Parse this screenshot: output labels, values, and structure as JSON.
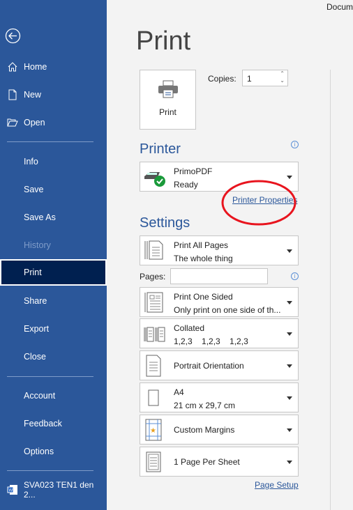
{
  "window_title": "Docum",
  "sidebar": {
    "items": [
      {
        "label": "Home",
        "icon": "home-icon"
      },
      {
        "label": "New",
        "icon": "new-document-icon"
      },
      {
        "label": "Open",
        "icon": "folder-open-icon"
      },
      {
        "label": "Info"
      },
      {
        "label": "Save"
      },
      {
        "label": "Save As"
      },
      {
        "label": "History",
        "disabled": true
      },
      {
        "label": "Print",
        "selected": true
      },
      {
        "label": "Share"
      },
      {
        "label": "Export"
      },
      {
        "label": "Close"
      },
      {
        "label": "Account"
      },
      {
        "label": "Feedback"
      },
      {
        "label": "Options"
      }
    ],
    "recent_doc": "SVA023 TEN1 den 2..."
  },
  "main": {
    "title": "Print",
    "print_button": "Print",
    "copies_label": "Copies:",
    "copies_value": "1",
    "printer_heading": "Printer",
    "printer": {
      "name": "PrimoPDF",
      "status": "Ready"
    },
    "printer_properties": "Printer Properties",
    "settings_heading": "Settings",
    "pages_label": "Pages:",
    "pages_value": "",
    "settings": [
      {
        "line1": "Print All Pages",
        "line2": "The whole thing"
      },
      {
        "line1": "Print One Sided",
        "line2": "Only print on one side of th..."
      },
      {
        "line1": "Collated",
        "line2": "1,2,3    1,2,3    1,2,3"
      },
      {
        "line1": "Portrait Orientation"
      },
      {
        "line1": "A4",
        "line2": "21 cm x 29,7 cm"
      },
      {
        "line1": "Custom Margins"
      },
      {
        "line1": "1 Page Per Sheet"
      }
    ],
    "page_setup": "Page Setup"
  },
  "colors": {
    "sidebar": "#2b579a",
    "selected": "#002050",
    "annotation": "#e8141e"
  }
}
